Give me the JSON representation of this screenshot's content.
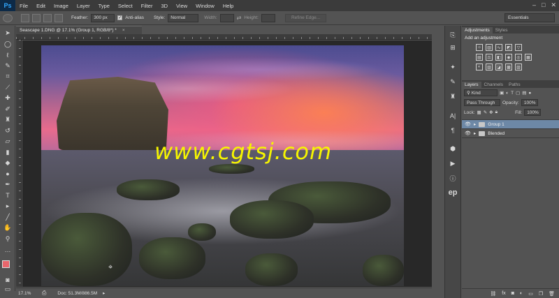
{
  "app": {
    "logo": "Ps",
    "menu": [
      "File",
      "Edit",
      "Image",
      "Layer",
      "Type",
      "Select",
      "Filter",
      "3D",
      "View",
      "Window",
      "Help"
    ],
    "window_controls": [
      "–",
      "□",
      "✕"
    ]
  },
  "options": {
    "feather_label": "Feather:",
    "feather_value": "300 px",
    "antialias_label": "Anti-alias",
    "style_label": "Style:",
    "style_value": "Normal",
    "width_label": "Width:",
    "height_label": "Height:",
    "refine_label": "Refine Edge...",
    "workspace": "Essentials"
  },
  "document": {
    "tab_title": "Seascape 1.DNG @ 17.1% (Group 1, RGB/8*) *",
    "tab_close": "×",
    "watermark": "www.cgtsj.com",
    "zoom": "17.1%",
    "doc_size": "Doc: 51.3M/886.5M"
  },
  "panels": {
    "adjustments_tab": "Adjustments",
    "styles_tab": "Styles",
    "add_adjustment": "Add an adjustment",
    "layers_tab": "Layers",
    "channels_tab": "Channels",
    "paths_tab": "Paths",
    "kind_label": "Kind",
    "blend_mode": "Pass Through",
    "opacity_label": "Opacity:",
    "opacity_value": "100%",
    "lock_label": "Lock:",
    "fill_label": "Fill:",
    "fill_value": "100%",
    "layers": [
      {
        "name": "Group 1"
      },
      {
        "name": "Blended"
      }
    ],
    "footer_icons": [
      "link-icon",
      "fx-icon",
      "mask-icon",
      "adjustment-icon",
      "folder-icon",
      "new-layer-icon",
      "trash-icon"
    ]
  },
  "colors": {
    "foreground": "#e8666c",
    "background": "#111111",
    "watermark": "#f6f500",
    "selected_layer": "#6d88a6"
  }
}
